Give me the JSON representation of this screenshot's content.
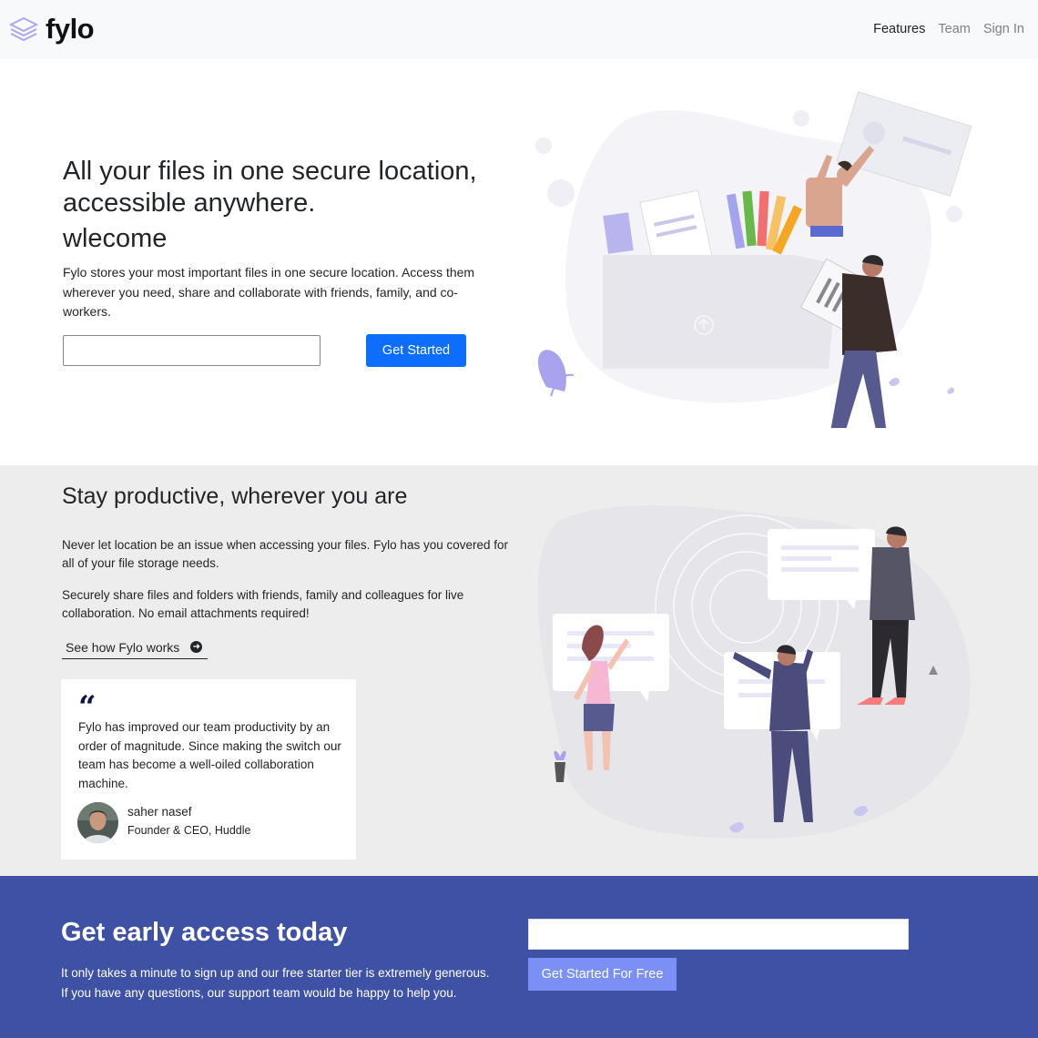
{
  "nav": {
    "brand": "fylo",
    "links": [
      "Features",
      "Team",
      "Sign In"
    ]
  },
  "hero": {
    "heading": "All your files in one secure location, accessible anywhere.",
    "welcome": "wlecome",
    "description": "Fylo stores your most important files in one secure location. Access them wherever you need, share and collaborate with friends, family, and co-workers.",
    "email_value": "",
    "cta": "Get Started"
  },
  "productive": {
    "heading": "Stay productive, wherever you are",
    "p1": "Never let location be an issue when accessing your files. Fylo has you covered for all of your file storage needs.",
    "p2": "Securely share files and folders with friends, family and colleagues for live collaboration. No email attachments required!",
    "link": "See how Fylo works",
    "testimonial": {
      "quote_mark": "“",
      "text": "Fylo has improved our team productivity by an order of magnitude. Since making the switch our team has become a well-oiled collaboration machine.",
      "name": "saher nasef",
      "role": "Founder & CEO, Huddle"
    }
  },
  "early_access": {
    "heading": "Get early access today",
    "text": "It only takes a minute to sign up and our free starter tier is extremely generous. If you have any questions, our support team would be happy to help you.",
    "email_value": "",
    "cta": "Get Started For Free"
  },
  "colors": {
    "primary_button": "#0d6efd",
    "early_bg": "#3f51a4",
    "free_button": "#7b8ff5",
    "section_bg": "#ededed",
    "nav_bg": "#f8f9fa"
  }
}
